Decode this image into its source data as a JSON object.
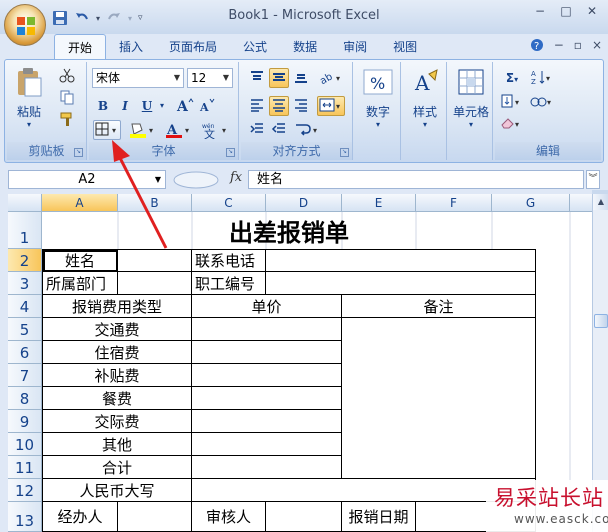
{
  "window": {
    "title": "Book1 - Microsoft Excel",
    "controls": [
      "−",
      "□",
      "✕"
    ]
  },
  "ribbon_tabs": [
    "开始",
    "插入",
    "页面布局",
    "公式",
    "数据",
    "审阅",
    "视图"
  ],
  "active_tab": "开始",
  "ribbon": {
    "clipboard": {
      "label": "剪贴板",
      "paste": "粘贴"
    },
    "font": {
      "label": "字体",
      "font_name": "宋体",
      "font_size": "12",
      "bold": "B",
      "italic": "I",
      "underline": "U"
    },
    "alignment": {
      "label": "对齐方式"
    },
    "number": {
      "label": "数字"
    },
    "styles": {
      "label": "样式"
    },
    "cells": {
      "label": "单元格"
    },
    "editing": {
      "label": "编辑"
    }
  },
  "formula_bar": {
    "name_box": "A2",
    "fx": "fx",
    "content": "姓名"
  },
  "sheet": {
    "columns": [
      "A",
      "B",
      "C",
      "D",
      "E",
      "F",
      "G"
    ],
    "rows": [
      "1",
      "2",
      "3",
      "4",
      "5",
      "6",
      "7",
      "8",
      "9",
      "10",
      "11",
      "12",
      "13"
    ],
    "title": "出差报销单",
    "labels": {
      "name": "姓名",
      "phone": "联系电话",
      "dept": "所属部门",
      "emp_no": "职工编号",
      "expense_type": "报销费用类型",
      "unit_price": "单价",
      "remark": "备注",
      "transport": "交通费",
      "lodging": "住宿费",
      "subsidy": "补贴费",
      "meal": "餐费",
      "social": "交际费",
      "other": "其他",
      "total": "合计",
      "rmb_upper": "人民币大写",
      "handler": "经办人",
      "auditor": "审核人",
      "report_date": "报销日期"
    }
  },
  "accent": {
    "selection_header": "#f8c55a",
    "ribbon_border": "#8db2e3",
    "arrow": "#e02020"
  },
  "watermark": {
    "title": "易采站长站",
    "url": "www.easck.com"
  }
}
